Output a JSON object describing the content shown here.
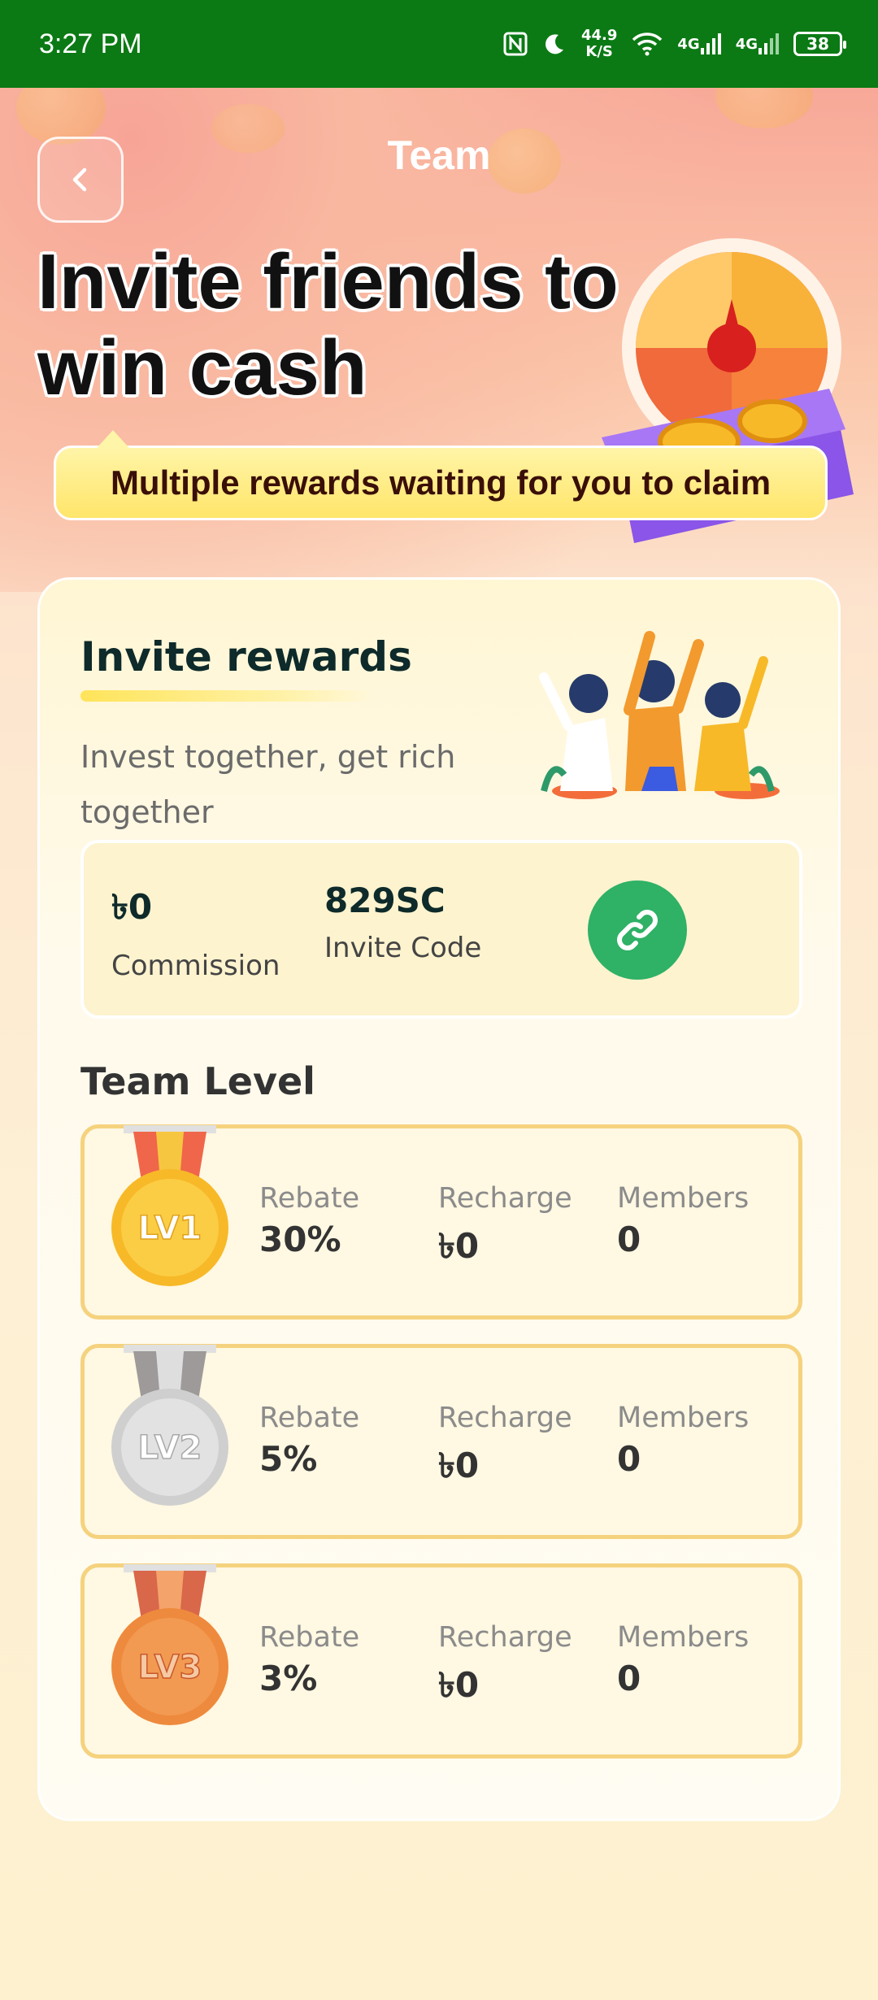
{
  "status_bar": {
    "time": "3:27 PM",
    "net_speed_value": "44.9",
    "net_speed_unit": "K/S",
    "sig1": "4G",
    "sig2": "4G",
    "battery": "38"
  },
  "header": {
    "title": "Team"
  },
  "hero": {
    "headline_line1": "Invite friends to",
    "headline_line2": "win cash",
    "ribbon_text": "Multiple rewards waiting for you to claim"
  },
  "invite": {
    "title": "Invite rewards",
    "subtitle": "Invest together, get rich together",
    "commission_value": "৳0",
    "commission_label": "Commission",
    "invite_code_value": "829SC",
    "invite_code_label": "Invite Code"
  },
  "team_level": {
    "title": "Team Level",
    "levels": [
      {
        "badge": "LV1",
        "rebate_label": "Rebate",
        "rebate": "30%",
        "recharge_label": "Recharge",
        "recharge": "৳0",
        "members_label": "Members",
        "members": "0"
      },
      {
        "badge": "LV2",
        "rebate_label": "Rebate",
        "rebate": "5%",
        "recharge_label": "Recharge",
        "recharge": "৳0",
        "members_label": "Members",
        "members": "0"
      },
      {
        "badge": "LV3",
        "rebate_label": "Rebate",
        "rebate": "3%",
        "recharge_label": "Recharge",
        "recharge": "৳0",
        "members_label": "Members",
        "members": "0"
      }
    ]
  },
  "colors": {
    "status_bar": "#0b7a14",
    "link_button": "#2fb166",
    "level_border": "#f5d27e",
    "lv1_medal": "#f7b928",
    "lv2_medal": "#cfcfcf",
    "lv3_medal": "#ee8a3d"
  },
  "icons": [
    "back-arrow-icon",
    "link-icon",
    "nfc-icon",
    "moon-icon",
    "wifi-icon",
    "signal-icon",
    "battery-icon"
  ]
}
